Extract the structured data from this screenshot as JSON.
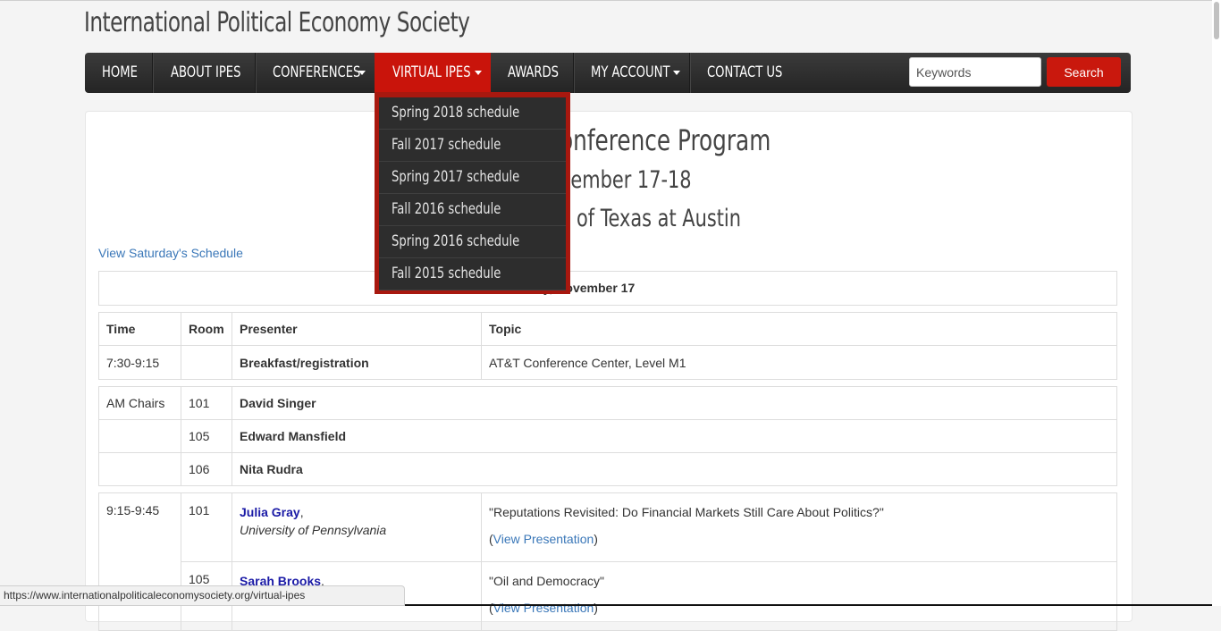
{
  "site": {
    "title": "International Political Economy Society"
  },
  "nav": {
    "home": "HOME",
    "about": "ABOUT IPES",
    "conferences": "CONFERENCES",
    "virtual": "VIRTUAL IPES",
    "awards": "AWARDS",
    "account": "MY ACCOUNT",
    "contact": "CONTACT US"
  },
  "search": {
    "placeholder": "Keywords",
    "button": "Search"
  },
  "dropdown": {
    "items": [
      "Spring 2018 schedule",
      "Fall 2017 schedule",
      "Spring 2017 schedule",
      "Fall 2016 schedule",
      "Spring 2016 schedule",
      "Fall 2015 schedule"
    ]
  },
  "page": {
    "heading_partial": "onference Program",
    "dates_partial": "vember 17-18",
    "location_partial": "y of Texas at Austin",
    "schedule_link": "View Saturday's Schedule",
    "day_header_partial": "ay, November 17"
  },
  "table": {
    "headers": {
      "time": "Time",
      "room": "Room",
      "presenter": "Presenter",
      "topic": "Topic"
    },
    "breakfast": {
      "time": "7:30-9:15",
      "presenter": "Breakfast/registration",
      "topic": "AT&T Conference Center, Level M1"
    },
    "chairs": {
      "label": "AM Chairs",
      "rows": [
        {
          "room": "101",
          "name": "David Singer"
        },
        {
          "room": "105",
          "name": "Edward Mansfield"
        },
        {
          "room": "106",
          "name": "Nita Rudra"
        }
      ]
    },
    "session1": {
      "time": "9:15-9:45",
      "rows": [
        {
          "room": "101",
          "name": "Julia Gray",
          "comma": ",",
          "affiliation": "University of Pennsylvania",
          "topic": "\"Reputations Revisited: Do Financial Markets Still Care About Politics?\"",
          "open": "(",
          "link": "View Presentation",
          "close": ")"
        },
        {
          "room": "105",
          "name": "Sarah Brooks",
          "comma": ",",
          "topic": "\"Oil and Democracy\"",
          "open": "(",
          "link": "View Presentation",
          "close": ")"
        }
      ]
    }
  },
  "status_url": "https://www.internationalpoliticaleconomysociety.org/virtual-ipes"
}
